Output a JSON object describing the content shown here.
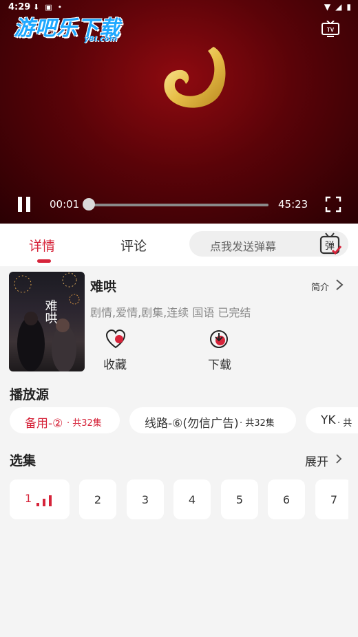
{
  "status_bar": {
    "time": "4:29"
  },
  "watermark": {
    "main": "游吧乐下载",
    "sub": "y8l.com"
  },
  "player": {
    "title": "难哄",
    "current_time": "00:01",
    "duration": "45:23",
    "progress": 0.0004
  },
  "tabs": [
    {
      "label": "详情",
      "active": true
    },
    {
      "label": "评论",
      "active": false
    }
  ],
  "danmu": {
    "placeholder": "点我发送弹幕",
    "icon_char": "弹"
  },
  "show": {
    "title": "难哄",
    "intro_label": "简介",
    "meta": "剧情,爱情,剧集,连续 国语 已完结",
    "poster_text": "难哄",
    "favorite_label": "收藏",
    "download_label": "下载"
  },
  "sources": {
    "title": "播放源",
    "items": [
      {
        "name": "备用-②",
        "count": " · 共32集",
        "active": true
      },
      {
        "name": "线路-⑥(勿信广告)",
        "count": " · 共32集",
        "active": false
      },
      {
        "name": "YK",
        "count": " · 共",
        "active": false
      }
    ]
  },
  "episodes": {
    "title": "选集",
    "expand_label": "展开",
    "items": [
      "1",
      "2",
      "3",
      "4",
      "5",
      "6",
      "7"
    ]
  },
  "colors": {
    "accent": "#d6243a",
    "watermark": "#1ea8ff",
    "player_bg": "#5a0308"
  }
}
